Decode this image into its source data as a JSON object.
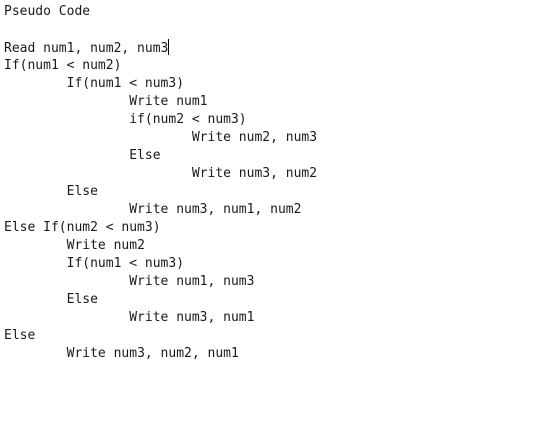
{
  "editor": {
    "lines": [
      "Pseudo Code",
      "",
      "Read num1, num2, num3",
      "If(num1 < num2)",
      "\tIf(num1 < num3)",
      "\t\tWrite num1",
      "\t\tif(num2 < num3)",
      "\t\t\tWrite num2, num3",
      "\t\tElse",
      "\t\t\tWrite num3, num2",
      "\tElse",
      "\t\tWrite num3, num1, num2",
      "Else If(num2 < num3)",
      "\tWrite num2",
      "\tIf(num1 < num3)",
      "\t\tWrite num1, num3",
      "\tElse",
      "\t\tWrite num3, num1",
      "Else",
      "\tWrite num3, num2, num1"
    ]
  }
}
